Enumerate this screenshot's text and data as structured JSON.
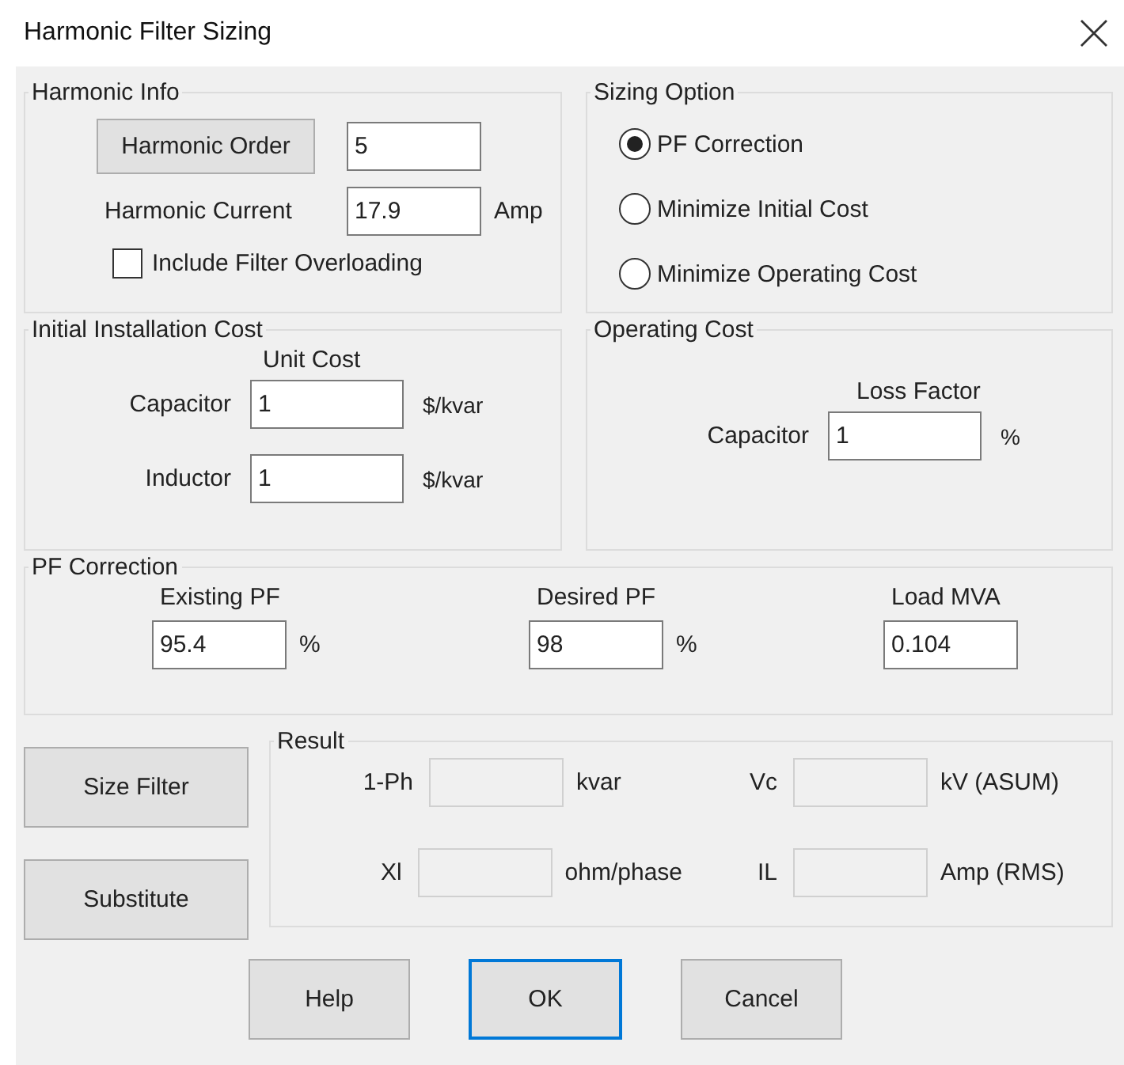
{
  "window": {
    "title": "Harmonic Filter Sizing"
  },
  "harmonic_info": {
    "title": "Harmonic Info",
    "order_button": "Harmonic Order",
    "order_value": "5",
    "current_label": "Harmonic Current",
    "current_value": "17.9",
    "current_unit": "Amp",
    "overloading": {
      "label": "Include Filter Overloading",
      "checked": false
    }
  },
  "sizing_option": {
    "title": "Sizing Option",
    "options": [
      {
        "label": "PF Correction",
        "selected": true
      },
      {
        "label": "Minimize Initial Cost",
        "selected": false
      },
      {
        "label": "Minimize Operating Cost",
        "selected": false
      }
    ]
  },
  "initial_cost": {
    "title": "Initial Installation Cost",
    "column_header": "Unit Cost",
    "rows": [
      {
        "label": "Capacitor",
        "value": "1",
        "unit": "$/kvar"
      },
      {
        "label": "Inductor",
        "value": "1",
        "unit": "$/kvar"
      }
    ]
  },
  "operating_cost": {
    "title": "Operating Cost",
    "column_header": "Loss Factor",
    "rows": [
      {
        "label": "Capacitor",
        "value": "1",
        "unit": "%"
      }
    ]
  },
  "pf_correction": {
    "title": "PF Correction",
    "fields": [
      {
        "label": "Existing PF",
        "value": "95.4",
        "unit": "%"
      },
      {
        "label": "Desired PF",
        "value": "98",
        "unit": "%"
      },
      {
        "label": "Load MVA",
        "value": "0.104"
      }
    ]
  },
  "actions": [
    "Size Filter",
    "Substitute"
  ],
  "result": {
    "title": "Result",
    "fields": [
      {
        "label": "1-Ph",
        "unit": "kvar",
        "disabled": true
      },
      {
        "label": "Vc",
        "unit": "kV (ASUM)",
        "disabled": true
      },
      {
        "label": "Xl",
        "unit": "ohm/phase",
        "disabled": true
      },
      {
        "label": "IL",
        "unit": "Amp (RMS)",
        "disabled": true
      }
    ]
  },
  "buttons": [
    {
      "label": "Help",
      "default": false
    },
    {
      "label": "OK",
      "default": true
    },
    {
      "label": "Cancel",
      "default": false
    }
  ]
}
